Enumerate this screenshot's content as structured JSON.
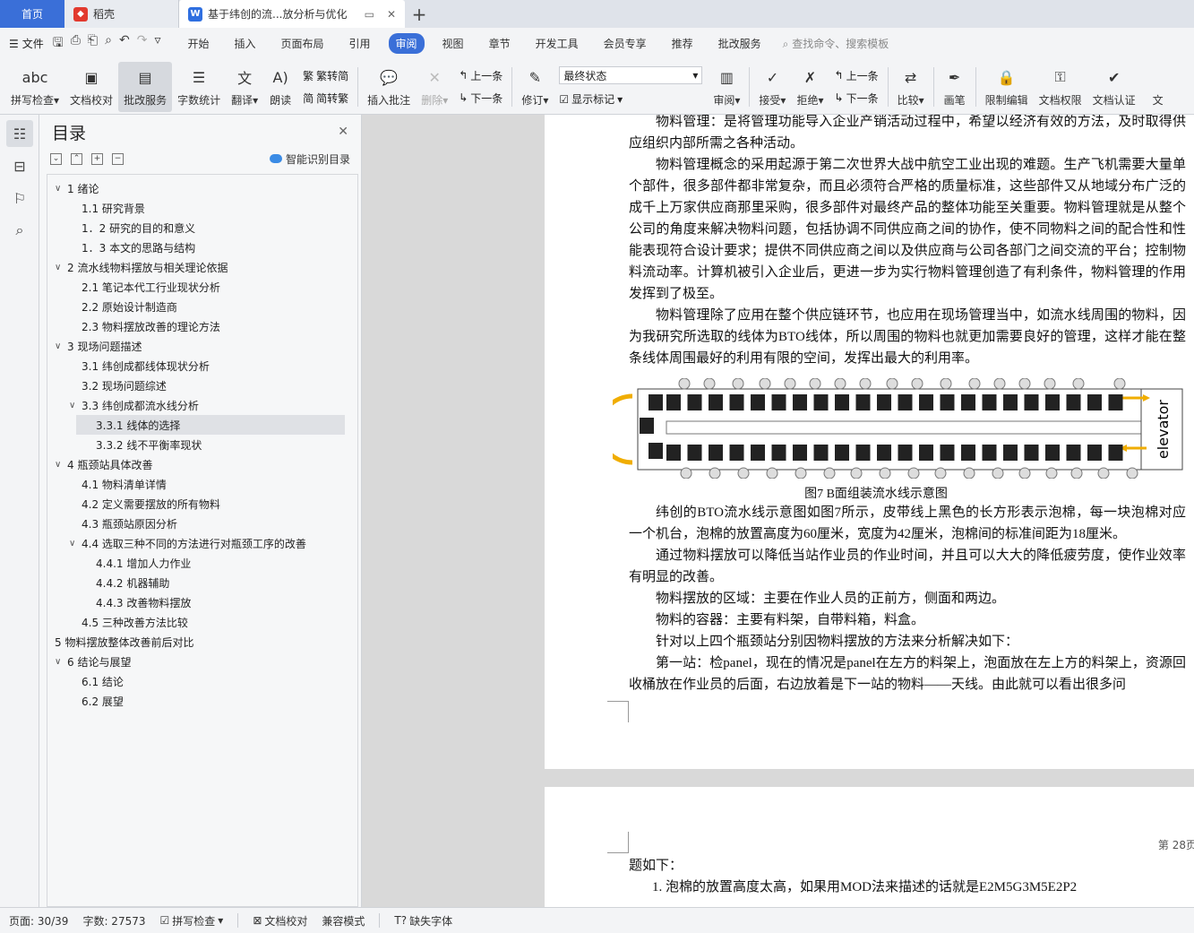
{
  "tabs": {
    "home": "首页",
    "daoke": "稻壳",
    "doc": "基于纬创的流...放分析与优化"
  },
  "menu": {
    "file": "文件",
    "items": [
      "开始",
      "插入",
      "页面布局",
      "引用",
      "审阅",
      "视图",
      "章节",
      "开发工具",
      "会员专享",
      "推荐",
      "批改服务"
    ],
    "active": "审阅",
    "search": "查找命令、搜索模板"
  },
  "ribbon": {
    "spell": "拼写检查",
    "proof": "文档校对",
    "correction": "批改服务",
    "wordcount": "字数统计",
    "translate": "翻译",
    "read": "朗读",
    "trad": "繁转简",
    "simp": "简转繁",
    "insert_comment": "插入批注",
    "delete": "删除",
    "prev": "上一条",
    "next": "下一条",
    "revise": "修订",
    "final_state": "最终状态",
    "show_marks": "显示标记",
    "review": "审阅",
    "accept": "接受",
    "reject": "拒绝",
    "prev2": "上一条",
    "next2": "下一条",
    "compare": "比较",
    "pen": "画笔",
    "restrict": "限制编辑",
    "permission": "文档权限",
    "certify": "文档认证",
    "more": "文"
  },
  "toc": {
    "title": "目录",
    "smart": "智能识别目录",
    "items": [
      {
        "level": 1,
        "arrow": "∨",
        "text": "1  绪论"
      },
      {
        "level": 2,
        "arrow": "",
        "text": "1.1 研究背景"
      },
      {
        "level": 2,
        "arrow": "",
        "text": "1．2 研究的目的和意义"
      },
      {
        "level": 2,
        "arrow": "",
        "text": "1．3 本文的思路与结构"
      },
      {
        "level": 1,
        "arrow": "∨",
        "text": "2  流水线物料摆放与相关理论依据"
      },
      {
        "level": 2,
        "arrow": "",
        "text": "2.1 笔记本代工行业现状分析"
      },
      {
        "level": 2,
        "arrow": "",
        "text": "2.2 原始设计制造商"
      },
      {
        "level": 2,
        "arrow": "",
        "text": "2.3 物料摆放改善的理论方法"
      },
      {
        "level": 1,
        "arrow": "∨",
        "text": "3 现场问题描述"
      },
      {
        "level": 2,
        "arrow": "",
        "text": "3.1 纬创成都线体现状分析"
      },
      {
        "level": 2,
        "arrow": "",
        "text": "3.2 现场问题综述"
      },
      {
        "level": 2,
        "arrow": "∨",
        "text": "3.3 纬创成都流水线分析"
      },
      {
        "level": 3,
        "arrow": "",
        "text": "3.3.1 线体的选择",
        "selected": true
      },
      {
        "level": 3,
        "arrow": "",
        "text": "3.3.2 线不平衡率现状"
      },
      {
        "level": 1,
        "arrow": "∨",
        "text": "4 瓶颈站具体改善"
      },
      {
        "level": 2,
        "arrow": "",
        "text": "4.1 物料清单详情"
      },
      {
        "level": 2,
        "arrow": "",
        "text": "4.2 定义需要摆放的所有物料"
      },
      {
        "level": 2,
        "arrow": "",
        "text": "4.3 瓶颈站原因分析"
      },
      {
        "level": 2,
        "arrow": "∨",
        "text": "4.4 选取三种不同的方法进行对瓶颈工序的改善"
      },
      {
        "level": 3,
        "arrow": "",
        "text": "4.4.1 增加人力作业"
      },
      {
        "level": 3,
        "arrow": "",
        "text": "4.4.2 机器辅助"
      },
      {
        "level": 3,
        "arrow": "",
        "text": "4.4.3 改善物料摆放"
      },
      {
        "level": 2,
        "arrow": "",
        "text": "4.5 三种改善方法比较"
      },
      {
        "level": 1,
        "arrow": "",
        "text": "5  物料摆放整体改善前后对比"
      },
      {
        "level": 1,
        "arrow": "∨",
        "text": "6  结论与展望"
      },
      {
        "level": 2,
        "arrow": "",
        "text": "6.1 结论"
      },
      {
        "level": 2,
        "arrow": "",
        "text": "6.2 展望"
      }
    ]
  },
  "page1": {
    "p0": "物料管理：是将管理功能导入企业产销活动过程中，希望以经济有效的方法，及时取得供应组织内部所需之各种活动。",
    "p1": "物料管理概念的采用起源于第二次世界大战中航空工业出现的难题。生产飞机需要大量单个部件，很多部件都非常复杂，而且必须符合严格的质量标准，这些部件又从地域分布广泛的成千上万家供应商那里采购，很多部件对最终产品的整体功能至关重要。物料管理就是从整个公司的角度来解决物料问题，包括协调不同供应商之间的协作，使不同物料之间的配合性和性能表现符合设计要求；提供不同供应商之间以及供应商与公司各部门之间交流的平台；控制物料流动率。计算机被引入企业后，更进一步为实行物料管理创造了有利条件，物料管理的作用发挥到了极至。",
    "p2": "物料管理除了应用在整个供应链环节，也应用在现场管理当中，如流水线周围的物料，因为我研究所选取的线体为BTO线体，所以周围的物料也就更加需要良好的管理，这样才能在整条线体周围最好的利用有限的空间，发挥出最大的利用率。",
    "figure_label": "elevator",
    "caption": "图7    B面组装流水线示意图",
    "p3": "纬创的BTO流水线示意图如图7所示，皮带线上黑色的长方形表示泡棉，每一块泡棉对应一个机台，泡棉的放置高度为60厘米，宽度为42厘米，泡棉间的标准间距为18厘米。",
    "p4": "通过物料摆放可以降低当站作业员的作业时间，并且可以大大的降低疲劳度，使作业效率有明显的改善。",
    "p5": "物料摆放的区域：主要在作业人员的正前方，侧面和两边。",
    "p6": "物料的容器：主要有料架，自带料箱，料盒。",
    "p7": "针对以上四个瓶颈站分别因物料摆放的方法来分析解决如下：",
    "p8": "第一站：检panel，现在的情况是panel在左方的料架上，泡面放在左上方的料架上，资源回收桶放在作业员的后面，右边放着是下一站的物料——天线。由此就可以看出很多问"
  },
  "page2": {
    "page_num": "第 28页",
    "p0": "题如下：",
    "p1": "1.   泡棉的放置高度太高，如果用MOD法来描述的话就是E2M5G3M5E2P2"
  },
  "status": {
    "page": "页面: 30/39",
    "words": "字数: 27573",
    "spell": "拼写检查",
    "proof": "文档校对",
    "compat": "兼容模式",
    "missing_font": "缺失字体"
  }
}
